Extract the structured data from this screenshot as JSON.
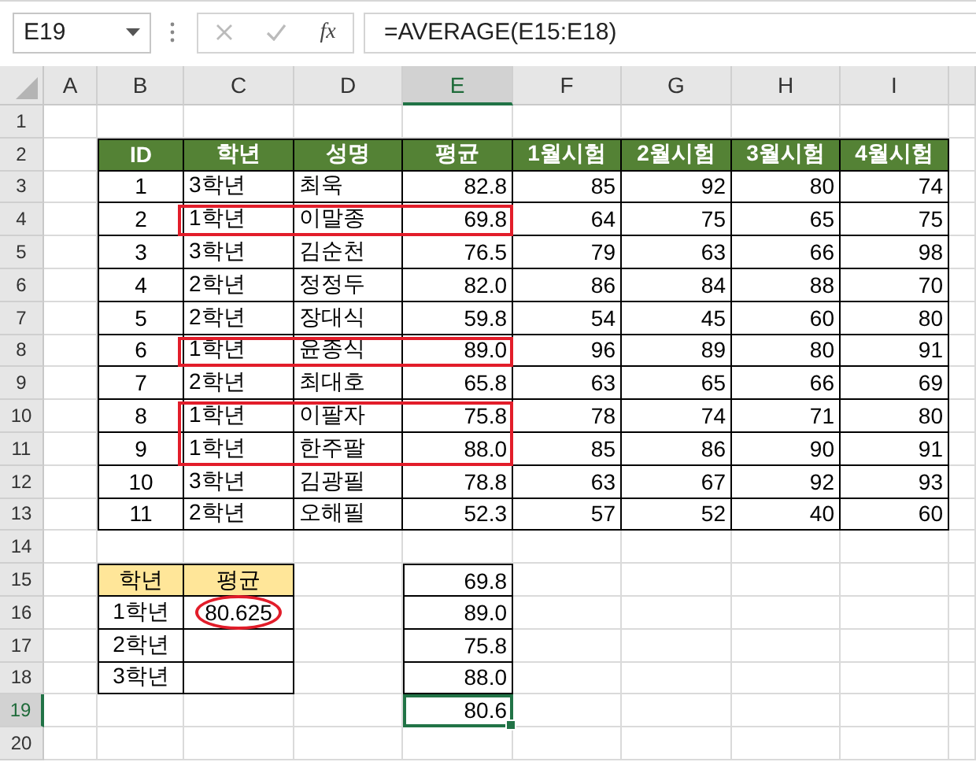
{
  "formula_bar": {
    "name_box": "E19",
    "fx": "fx",
    "formula": "=AVERAGE(E15:E18)"
  },
  "column_headers": [
    {
      "label": "A",
      "selected": false
    },
    {
      "label": "B",
      "selected": false
    },
    {
      "label": "C",
      "selected": false
    },
    {
      "label": "D",
      "selected": false
    },
    {
      "label": "E",
      "selected": true
    },
    {
      "label": "F",
      "selected": false
    },
    {
      "label": "G",
      "selected": false
    },
    {
      "label": "H",
      "selected": false
    },
    {
      "label": "I",
      "selected": false
    }
  ],
  "row_headers": [
    {
      "label": "1",
      "selected": false
    },
    {
      "label": "2",
      "selected": false
    },
    {
      "label": "3",
      "selected": false
    },
    {
      "label": "4",
      "selected": false
    },
    {
      "label": "5",
      "selected": false
    },
    {
      "label": "6",
      "selected": false
    },
    {
      "label": "7",
      "selected": false
    },
    {
      "label": "8",
      "selected": false
    },
    {
      "label": "9",
      "selected": false
    },
    {
      "label": "10",
      "selected": false
    },
    {
      "label": "11",
      "selected": false
    },
    {
      "label": "12",
      "selected": false
    },
    {
      "label": "13",
      "selected": false
    },
    {
      "label": "14",
      "selected": false
    },
    {
      "label": "15",
      "selected": false
    },
    {
      "label": "16",
      "selected": false
    },
    {
      "label": "17",
      "selected": false
    },
    {
      "label": "18",
      "selected": false
    },
    {
      "label": "19",
      "selected": true
    },
    {
      "label": "20",
      "selected": false
    }
  ],
  "score_table": {
    "columns": [
      "ID",
      "학년",
      "성명",
      "평균",
      "1월시험",
      "2월시험",
      "3월시험",
      "4월시험"
    ],
    "rows": [
      {
        "cells": [
          "1",
          "3학년",
          "최욱",
          "82.8",
          "85",
          "92",
          "80",
          "74"
        ],
        "highlighted": false
      },
      {
        "cells": [
          "2",
          "1학년",
          "이말종",
          "69.8",
          "64",
          "75",
          "65",
          "75"
        ],
        "highlighted": true
      },
      {
        "cells": [
          "3",
          "3학년",
          "김순천",
          "76.5",
          "79",
          "63",
          "66",
          "98"
        ],
        "highlighted": false
      },
      {
        "cells": [
          "4",
          "2학년",
          "정정두",
          "82.0",
          "86",
          "84",
          "88",
          "70"
        ],
        "highlighted": false
      },
      {
        "cells": [
          "5",
          "2학년",
          "장대식",
          "59.8",
          "54",
          "45",
          "60",
          "80"
        ],
        "highlighted": false
      },
      {
        "cells": [
          "6",
          "1학년",
          "윤종식",
          "89.0",
          "96",
          "89",
          "80",
          "91"
        ],
        "highlighted": true
      },
      {
        "cells": [
          "7",
          "2학년",
          "최대호",
          "65.8",
          "63",
          "65",
          "66",
          "69"
        ],
        "highlighted": false
      },
      {
        "cells": [
          "8",
          "1학년",
          "이팔자",
          "75.8",
          "78",
          "74",
          "71",
          "80"
        ],
        "highlighted": true
      },
      {
        "cells": [
          "9",
          "1학년",
          "한주팔",
          "88.0",
          "85",
          "86",
          "90",
          "91"
        ],
        "highlighted": true
      },
      {
        "cells": [
          "10",
          "3학년",
          "김광필",
          "78.8",
          "63",
          "67",
          "92",
          "93"
        ],
        "highlighted": false
      },
      {
        "cells": [
          "11",
          "2학년",
          "오해필",
          "52.3",
          "57",
          "52",
          "40",
          "60"
        ],
        "highlighted": false
      }
    ]
  },
  "grade_table": {
    "columns": [
      "학년",
      "평균"
    ],
    "rows": [
      {
        "grade": "1학년",
        "average": "80.625",
        "circled": true
      },
      {
        "grade": "2학년",
        "circled": false
      },
      {
        "grade": "3학년",
        "circled": false
      }
    ]
  },
  "value_list": {
    "values": [
      "69.8",
      "89.0",
      "75.8",
      "88.0"
    ],
    "result": "80.6",
    "result_selected": true
  }
}
